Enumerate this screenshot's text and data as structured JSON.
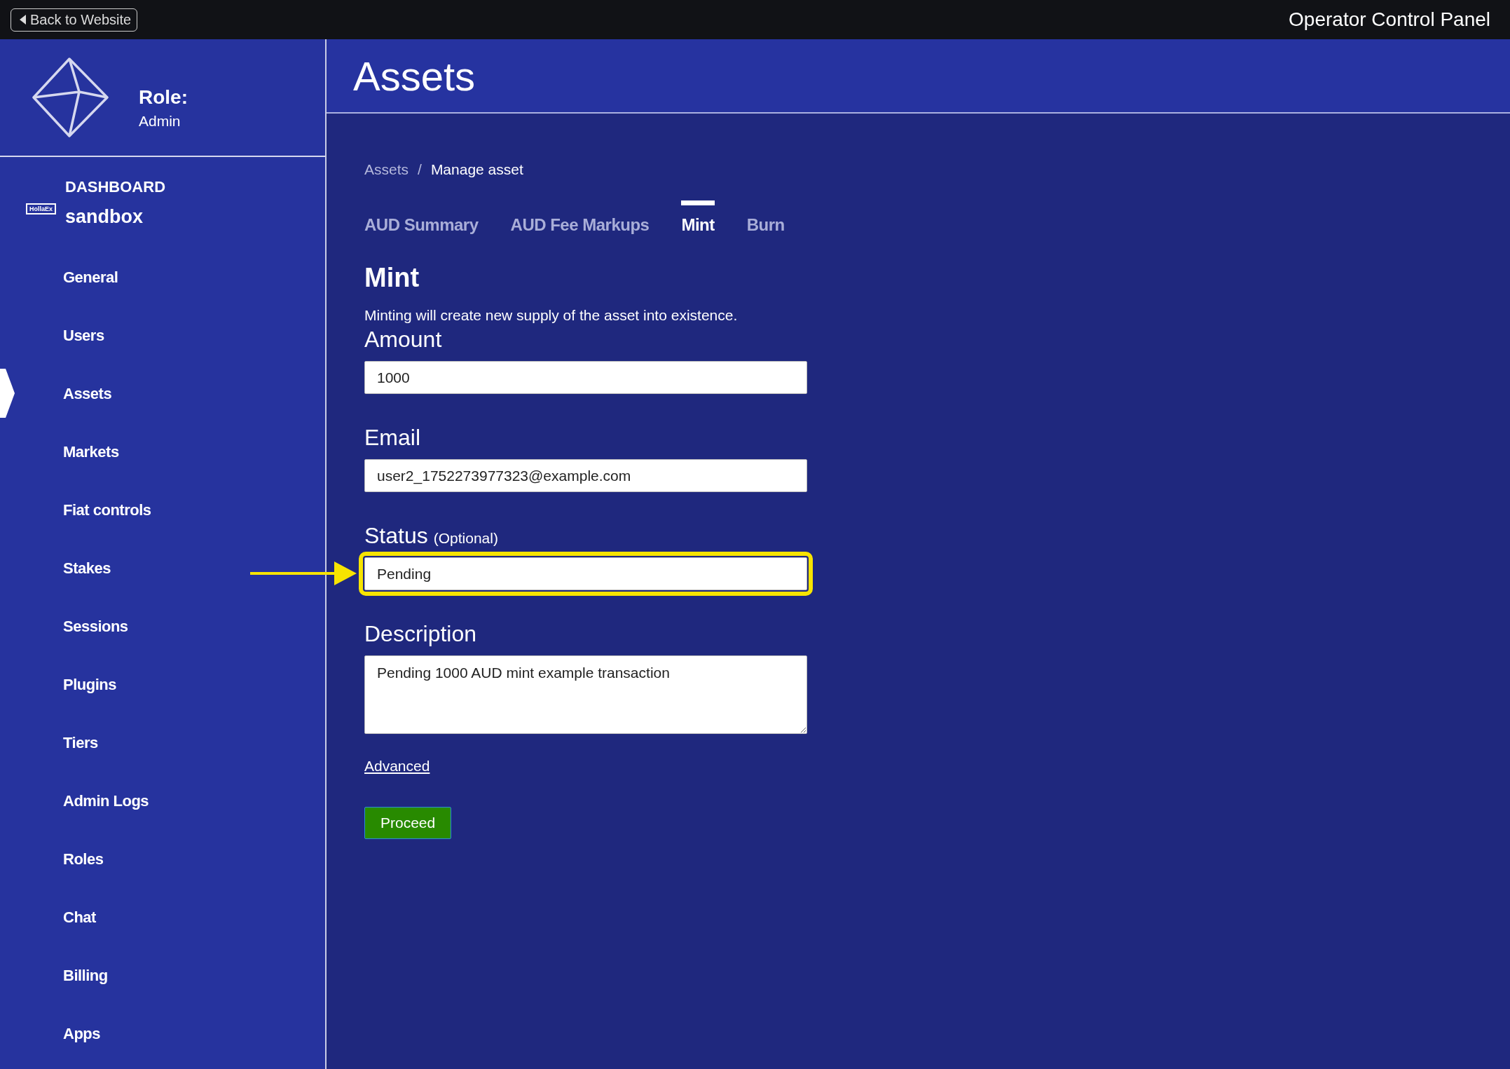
{
  "top_bar": {
    "back_button": "Back to Website",
    "title": "Operator Control Panel"
  },
  "sidebar": {
    "role_label": "Role:",
    "role_value": "Admin",
    "dashboard_label": "DASHBOARD",
    "exchange_name": "sandbox",
    "logo_text": "HollaEx",
    "items": [
      {
        "label": "General",
        "selected": false
      },
      {
        "label": "Users",
        "selected": false
      },
      {
        "label": "Assets",
        "selected": true
      },
      {
        "label": "Markets",
        "selected": false
      },
      {
        "label": "Fiat controls",
        "selected": false
      },
      {
        "label": "Stakes",
        "selected": false
      },
      {
        "label": "Sessions",
        "selected": false
      },
      {
        "label": "Plugins",
        "selected": false
      },
      {
        "label": "Tiers",
        "selected": false
      },
      {
        "label": "Admin Logs",
        "selected": false
      },
      {
        "label": "Roles",
        "selected": false
      },
      {
        "label": "Chat",
        "selected": false
      },
      {
        "label": "Billing",
        "selected": false
      },
      {
        "label": "Apps",
        "selected": false
      }
    ]
  },
  "page_title": "Assets",
  "breadcrumb": {
    "separator": "/",
    "items": [
      "Assets",
      "Manage asset"
    ]
  },
  "tabs": [
    {
      "label": "AUD Summary",
      "selected": false
    },
    {
      "label": "AUD Fee Markups",
      "selected": false
    },
    {
      "label": "Mint",
      "selected": true
    },
    {
      "label": "Burn",
      "selected": false
    }
  ],
  "form": {
    "title": "Mint",
    "description": "Minting will create new supply of the asset into existence.",
    "fields": [
      {
        "kind": "input",
        "label": "Amount",
        "value": "1000",
        "highlighted": false
      },
      {
        "kind": "input",
        "label": "Email",
        "value": "user2_1752273977323@example.com",
        "highlighted": false
      },
      {
        "kind": "input",
        "label": "Status",
        "hint": "(Optional)",
        "value": "Pending",
        "highlighted": true
      },
      {
        "kind": "textarea",
        "label": "Description",
        "value": "Pending 1000 AUD mint example transaction",
        "highlighted": false
      }
    ],
    "advanced_link": "Advanced",
    "submit_button": "Proceed"
  }
}
